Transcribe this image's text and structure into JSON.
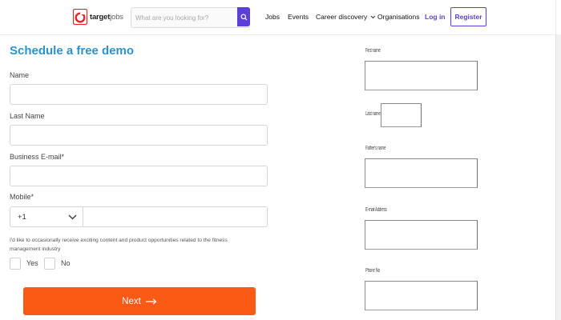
{
  "header": {
    "logo_bold": "target",
    "logo_light": "jobs",
    "logo_icon": "target-jobs-logo-icon",
    "search": {
      "placeholder": "What are you looking for?",
      "icon": "search-icon"
    },
    "nav": {
      "jobs": "Jobs",
      "events": "Events",
      "career": "Career discovery",
      "career_icon": "chevron-down-icon",
      "organisations": "Organisations",
      "login": "Log in",
      "register": "Register"
    },
    "colors": {
      "brand_purple": "#5b3fd6",
      "logo_red": "#e8262a"
    }
  },
  "demo_form": {
    "title": "Schedule a free demo",
    "name_label": "Name",
    "last_name_label": "Last Name",
    "email_label": "Business E-mail*",
    "mobile_label": "Mobile*",
    "country_code": "+1",
    "country_icon": "chevron-down-icon",
    "consent_text": "I'd like to occasionally receive exciting content and product opportunities related to the fitness management industry",
    "yes_label": "Yes",
    "no_label": "No",
    "next_label": "Next",
    "next_icon": "arrow-right-icon",
    "colors": {
      "title": "#2b93cf",
      "next_button": "#fb5a15"
    }
  },
  "side_form": {
    "first_name_label": "First name",
    "last_name_label": "Last name",
    "father_name_label": "Father's name",
    "email_label": "E-mail Address",
    "phone_label": "Phone No"
  }
}
